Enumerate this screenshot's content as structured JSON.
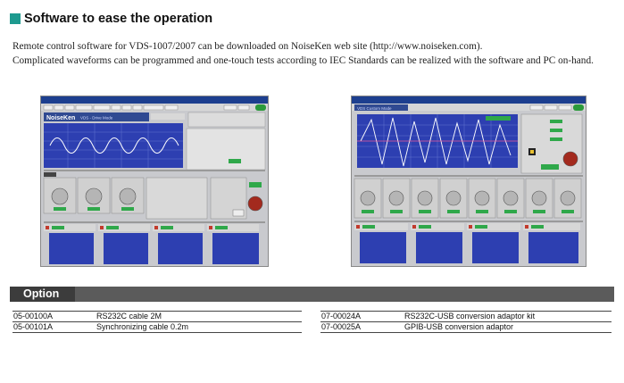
{
  "section": {
    "title": "Software to ease the operation",
    "intro_line1": "Remote control software for VDS-1007/2007 can be downloaded on NoiseKen web site (http://www.noiseken.com).",
    "intro_line2": "Complicated waveforms can be programmed and one-touch tests according to IEC Standards can be realized with the software and PC on-hand."
  },
  "screenshots": {
    "left": {
      "brand": "NoiseKen",
      "mode_label": "VDS - Drive Mode"
    },
    "right": {
      "title": "VDS Custom Mode"
    }
  },
  "option": {
    "heading": "Option",
    "left_items": [
      {
        "code": "05-00100A",
        "description": "RS232C cable 2M"
      },
      {
        "code": "05-00101A",
        "description": "Synchronizing cable 0.2m"
      }
    ],
    "right_items": [
      {
        "code": "07-00024A",
        "description": "RS232C-USB conversion adaptor kit"
      },
      {
        "code": "07-00025A",
        "description": "GPIB-USB conversion adaptor"
      }
    ]
  },
  "colors": {
    "accent": "#1e9a8f",
    "option_bar": "#5b5b5b",
    "option_label": "#3c3c3c"
  }
}
